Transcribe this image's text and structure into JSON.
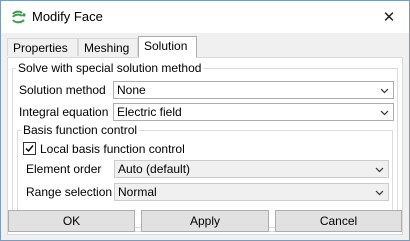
{
  "window": {
    "title": "Modify Face",
    "close_glyph": "✕"
  },
  "tabs": [
    {
      "label": "Properties",
      "active": false
    },
    {
      "label": "Meshing",
      "active": false
    },
    {
      "label": "Solution",
      "active": true
    }
  ],
  "solve_group": {
    "title": "Solve with special solution method",
    "solution_method": {
      "label": "Solution method",
      "value": "None"
    },
    "integral_equation": {
      "label": "Integral equation",
      "value": "Electric field"
    }
  },
  "basis_group": {
    "title": "Basis function control",
    "local_control": {
      "label": "Local basis function control",
      "checked": true
    },
    "element_order": {
      "label": "Element order",
      "value": "Auto (default)"
    },
    "range_selection": {
      "label": "Range selection",
      "value": "Normal"
    }
  },
  "buttons": {
    "ok": "OK",
    "apply": "Apply",
    "cancel": "Cancel"
  },
  "colors": {
    "icon_green": "#3c9e4b",
    "tab_border": "#adadad",
    "button_bg": "#e1e1e1"
  }
}
